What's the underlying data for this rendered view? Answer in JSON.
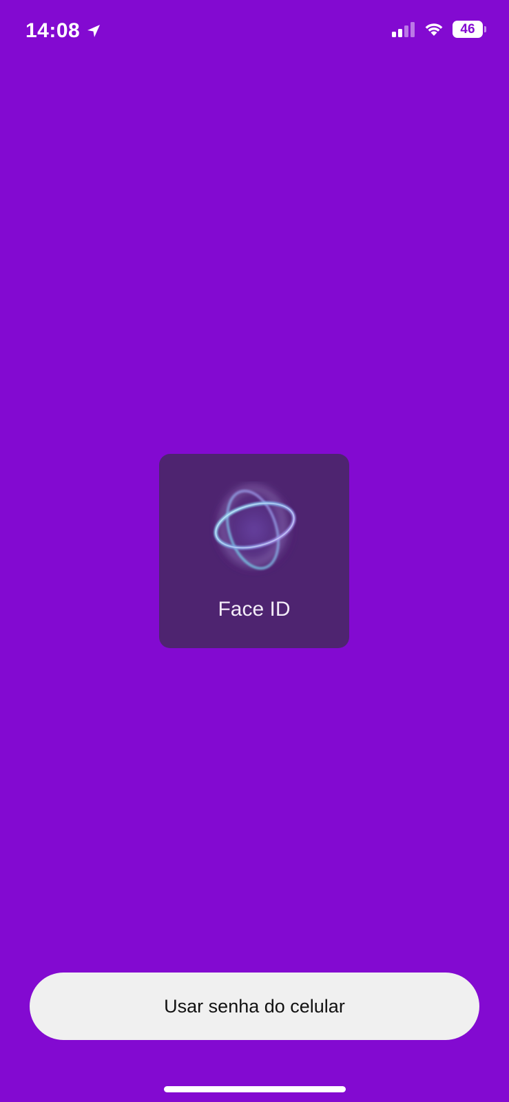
{
  "status_bar": {
    "time": "14:08",
    "battery_level": "46",
    "signal_icon": "cellular-signal-icon",
    "wifi_icon": "wifi-icon",
    "location_icon": "location-arrow-icon"
  },
  "faceid": {
    "label": "Face ID",
    "icon": "face-id-animation-icon"
  },
  "passcode_button": {
    "label": "Usar senha do celular"
  },
  "colors": {
    "background": "#830AD1",
    "panel": "#4E2470",
    "button": "#F0F0F0",
    "button_text": "#111111"
  }
}
